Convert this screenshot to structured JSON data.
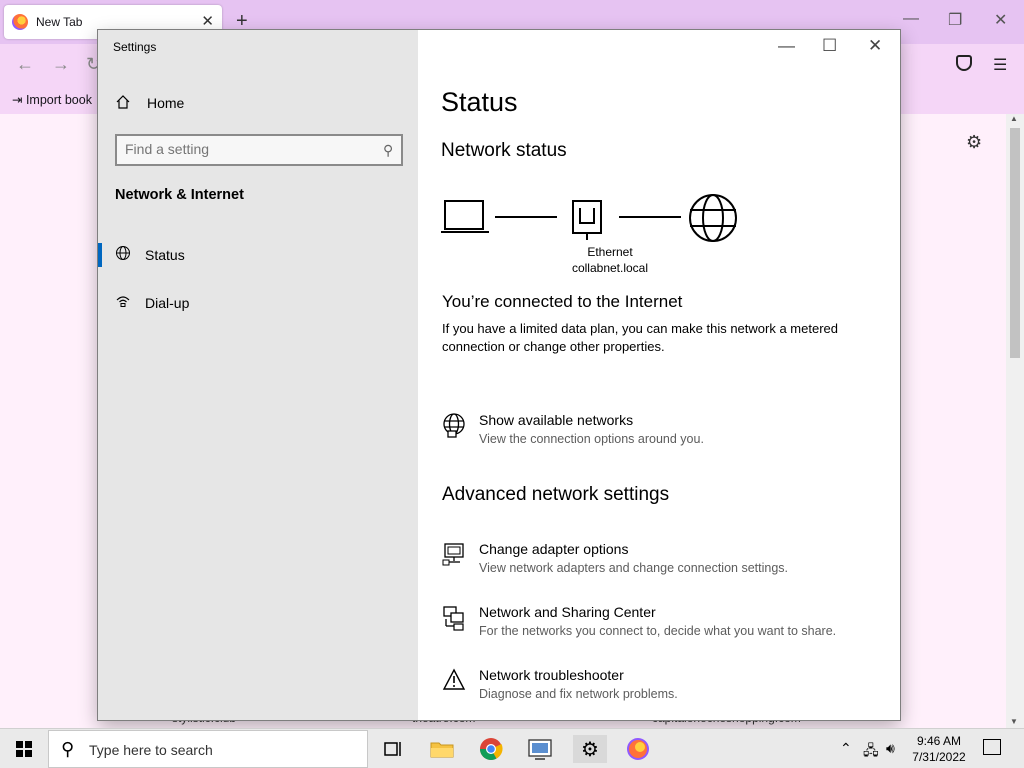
{
  "browser": {
    "tab_title": "New Tab",
    "import_label": "Import book",
    "site_links": [
      "stylistic.club",
      "theatre.com",
      "capitalonecheshopping.com"
    ]
  },
  "settings": {
    "window_title": "Settings",
    "home_label": "Home",
    "search_placeholder": "Find a setting",
    "section": "Network & Internet",
    "nav": [
      {
        "label": "Status",
        "selected": true
      },
      {
        "label": "Dial-up",
        "selected": false
      }
    ],
    "main": {
      "title": "Status",
      "network_status": "Network status",
      "adapter_name": "Ethernet",
      "network_name": "collabnet.local",
      "connected_title": "You’re connected to the Internet",
      "connected_desc": "If you have a limited data plan, you can make this network a metered connection or change other properties.",
      "show_networks": {
        "title": "Show available networks",
        "subtitle": "View the connection options around you."
      },
      "advanced_title": "Advanced network settings",
      "advanced": [
        {
          "title": "Change adapter options",
          "subtitle": "View network adapters and change connection settings."
        },
        {
          "title": "Network and Sharing Center",
          "subtitle": "For the networks you connect to, decide what you want to share."
        },
        {
          "title": "Network troubleshooter",
          "subtitle": "Diagnose and fix network problems."
        }
      ]
    },
    "accent_color": "#0067c0"
  },
  "taskbar": {
    "search_placeholder": "Type here to search",
    "time": "9:46 AM",
    "date": "7/31/2022"
  }
}
